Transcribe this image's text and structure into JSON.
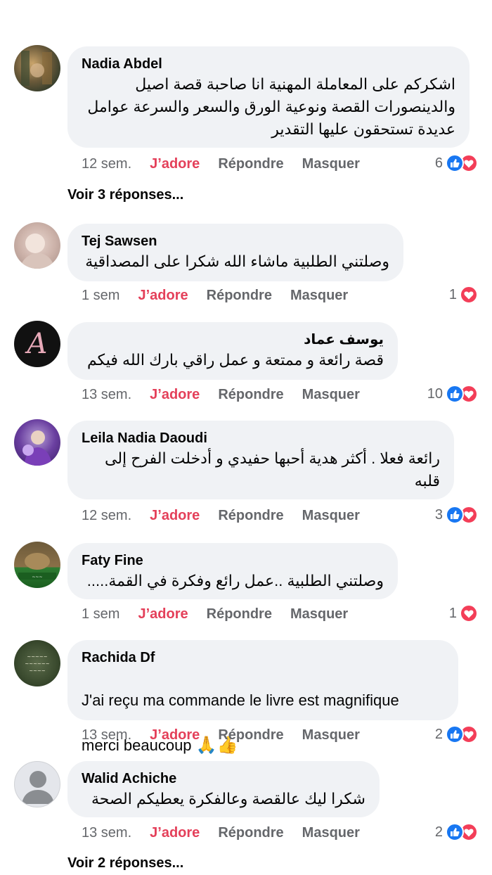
{
  "colors": {
    "bubble": "#f0f2f5",
    "like_text": "#e4405a",
    "meta_text": "#65676b",
    "like_icon": "#1877f2",
    "love_icon": "#f33e58"
  },
  "comments": [
    {
      "author": "Nadia Abdel",
      "text": "اشكركم على المعاملة المهنية انا صاحبة قصة اصيل\nوالدينصورات القصة ونوعية الورق والسعر والسرعة عوامل\nعديدة تستحقون عليها التقدير",
      "time": "12 sem.",
      "like": "J’adore",
      "reply": "Répondre",
      "hide": "Masquer",
      "reaction_count": "6",
      "reactions": [
        "like-icon",
        "love-icon"
      ],
      "more_replies": "Voir 3 réponses..."
    },
    {
      "author": "Tej Sawsen",
      "text": "وصلتني الطلبية ماشاء الله شكرا على المصداقية",
      "time": "1 sem",
      "like": "J’adore",
      "reply": "Répondre",
      "hide": "Masquer",
      "reaction_count": "1",
      "reactions": [
        "love-icon"
      ]
    },
    {
      "author": "يوسف عماد",
      "text": "قصة رائعة و ممتعة و عمل راقي بارك الله فيكم",
      "time": "13 sem.",
      "like": "J’adore",
      "reply": "Répondre",
      "hide": "Masquer",
      "reaction_count": "10",
      "reactions": [
        "like-icon",
        "love-icon"
      ]
    },
    {
      "author": "Leila Nadia Daoudi",
      "text": "رائعة فعلا . أكثر هدية أحبها حفيدي و أدخلت الفرح إلى\nقلبه",
      "time": "12 sem.",
      "like": "J’adore",
      "reply": "Répondre",
      "hide": "Masquer",
      "reaction_count": "3",
      "reactions": [
        "like-icon",
        "love-icon"
      ]
    },
    {
      "author": "Faty Fine",
      "text": "وصلتني الطلبية ..عمل رائع وفكرة في القمة.....",
      "time": "1 sem",
      "like": "J’adore",
      "reply": "Répondre",
      "hide": "Masquer",
      "reaction_count": "1",
      "reactions": [
        "love-icon"
      ]
    },
    {
      "author": "Rachida Df",
      "text_line1": "J'ai reçu ma commande le livre est magnifique",
      "text_line2": "merci beaucoup",
      "emojis": "🙏👍",
      "time": "13 sem.",
      "like": "J’adore",
      "reply": "Répondre",
      "hide": "Masquer",
      "reaction_count": "2",
      "reactions": [
        "like-icon",
        "love-icon"
      ]
    },
    {
      "author": "Walid Achiche",
      "text": "شكرا ليك عالقصة وعالفكرة يعطيكم الصحة",
      "time": "13 sem.",
      "like": "J’adore",
      "reply": "Répondre",
      "hide": "Masquer",
      "reaction_count": "2",
      "reactions": [
        "like-icon",
        "love-icon"
      ],
      "more_replies": "Voir 2 réponses..."
    }
  ]
}
